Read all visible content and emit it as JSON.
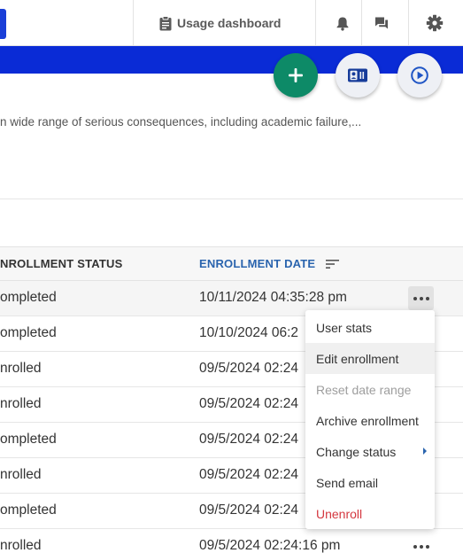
{
  "topnav": {
    "usage_label": "Usage dashboard",
    "icons": [
      "clipboard-icon",
      "bell-icon",
      "chat-icon",
      "gear-icon"
    ]
  },
  "fabs": {
    "add_icon": "plus-icon",
    "card_icon": "id-card-icon",
    "play_icon": "play-circle-icon"
  },
  "description": "n wide range of serious consequences, including academic failure,...",
  "table": {
    "headers": {
      "status": "NROLLMENT STATUS",
      "date": "ENROLLMENT DATE"
    },
    "rows": [
      {
        "status": "ompleted",
        "date": "10/11/2024 04:35:28 pm"
      },
      {
        "status": "ompleted",
        "date": "10/10/2024 06:2"
      },
      {
        "status": "nrolled",
        "date": "09/5/2024 02:24"
      },
      {
        "status": "nrolled",
        "date": "09/5/2024 02:24"
      },
      {
        "status": "ompleted",
        "date": "09/5/2024 02:24"
      },
      {
        "status": "nrolled",
        "date": "09/5/2024 02:24"
      },
      {
        "status": "ompleted",
        "date": "09/5/2024 02:24"
      },
      {
        "status": "nrolled",
        "date": "09/5/2024 02:24:16 pm"
      }
    ]
  },
  "menu": {
    "items": [
      {
        "label": "User stats"
      },
      {
        "label": "Edit enrollment"
      },
      {
        "label": "Reset date range"
      },
      {
        "label": "Archive enrollment"
      },
      {
        "label": "Change status"
      },
      {
        "label": "Send email"
      },
      {
        "label": "Unenroll"
      }
    ]
  },
  "colors": {
    "brand_blue": "#0a2bd6",
    "add_green": "#0d8a67",
    "link_blue": "#2a64ae",
    "danger_red": "#d4373f"
  }
}
